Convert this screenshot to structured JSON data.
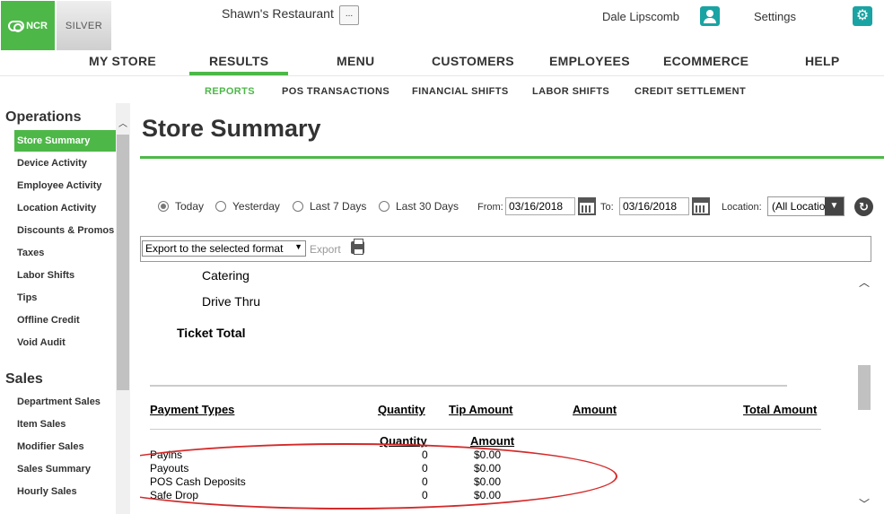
{
  "header": {
    "ncr_logo": "NCR",
    "silver_logo": "SILVER",
    "restaurant": "Shawn's Restaurant",
    "ellipsis": "...",
    "user": "Dale Lipscomb",
    "settings": "Settings"
  },
  "nav": {
    "items": [
      "MY STORE",
      "RESULTS",
      "MENU",
      "CUSTOMERS",
      "EMPLOYEES",
      "ECOMMERCE",
      "HELP"
    ],
    "active": "RESULTS"
  },
  "subnav": {
    "items": [
      "REPORTS",
      "POS TRANSACTIONS",
      "FINANCIAL SHIFTS",
      "LABOR SHIFTS",
      "CREDIT SETTLEMENT"
    ],
    "active": "REPORTS"
  },
  "sidebar": {
    "operations_heading": "Operations",
    "operations": [
      "Store Summary",
      "Device Activity",
      "Employee Activity",
      "Location Activity",
      "Discounts & Promos",
      "Taxes",
      "Labor Shifts",
      "Tips",
      "Offline Credit",
      "Void Audit"
    ],
    "active": "Store Summary",
    "sales_heading": "Sales",
    "sales": [
      "Department Sales",
      "Item Sales",
      "Modifier Sales",
      "Sales Summary",
      "Hourly Sales"
    ]
  },
  "page": {
    "title": "Store Summary"
  },
  "filters": {
    "ranges": [
      "Today",
      "Yesterday",
      "Last 7 Days",
      "Last 30 Days"
    ],
    "selected_range": "Today",
    "from_label": "From:",
    "from_value": "03/16/2018",
    "to_label": "To:",
    "to_value": "03/16/2018",
    "location_label": "Location:",
    "location_value": "(All Locatio"
  },
  "toolbar": {
    "export_format": "Export to the selected format",
    "export_label": "Export"
  },
  "report": {
    "lines": [
      "Catering",
      "Drive Thru"
    ],
    "ticket_total": "Ticket Total",
    "payment_columns": [
      "Payment Types",
      "Quantity",
      "Tip Amount",
      "Amount",
      "Total Amount"
    ],
    "sub_columns": [
      "Quantity",
      "Amount"
    ],
    "rows": [
      {
        "name": "Payins",
        "qty": "0",
        "amount": "$0.00"
      },
      {
        "name": "Payouts",
        "qty": "0",
        "amount": "$0.00"
      },
      {
        "name": "POS Cash Deposits",
        "qty": "0",
        "amount": "$0.00"
      },
      {
        "name": "Safe Drop",
        "qty": "0",
        "amount": "$0.00"
      }
    ]
  },
  "colors": {
    "accent": "#4db848",
    "teal": "#1aa3a3",
    "annotation": "#d42a2a"
  }
}
